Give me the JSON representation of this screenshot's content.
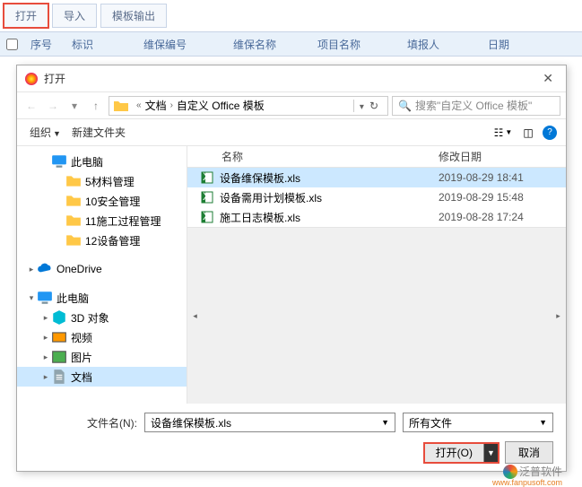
{
  "toolbar": {
    "open": "打开",
    "import": "导入",
    "tplout": "模板输出"
  },
  "grid": {
    "seq": "序号",
    "tag": "标识",
    "maintno": "维保编号",
    "maintname": "维保名称",
    "proj": "项目名称",
    "filler": "填报人",
    "date": "日期"
  },
  "dlg": {
    "title": "打开",
    "crumb": {
      "p1": "文档",
      "p2": "自定义 Office 模板"
    },
    "search_ph": "搜索\"自定义 Office 模板\"",
    "cmds": {
      "org": "组织",
      "newf": "新建文件夹"
    },
    "tree": [
      {
        "ind": 26,
        "exp": "",
        "icon": "pc",
        "label": "此电脑"
      },
      {
        "ind": 42,
        "exp": "",
        "icon": "folder",
        "label": "5材料管理"
      },
      {
        "ind": 42,
        "exp": "",
        "icon": "folder",
        "label": "10安全管理"
      },
      {
        "ind": 42,
        "exp": "",
        "icon": "folder",
        "label": "11施工过程管理"
      },
      {
        "ind": 42,
        "exp": "",
        "icon": "folder",
        "label": "12设备管理"
      },
      {
        "ind": 10,
        "exp": "▸",
        "icon": "onedrive",
        "label": "OneDrive",
        "gap": true
      },
      {
        "ind": 10,
        "exp": "▾",
        "icon": "pc",
        "label": "此电脑",
        "gap": true
      },
      {
        "ind": 26,
        "exp": "▸",
        "icon": "cube",
        "label": "3D 对象"
      },
      {
        "ind": 26,
        "exp": "▸",
        "icon": "video",
        "label": "视频"
      },
      {
        "ind": 26,
        "exp": "▸",
        "icon": "pic",
        "label": "图片"
      },
      {
        "ind": 26,
        "exp": "▸",
        "icon": "doc",
        "label": "文档",
        "sel": true
      }
    ],
    "list": {
      "hdr_name": "名称",
      "hdr_date": "修改日期",
      "rows": [
        {
          "name": "设备维保模板.xls",
          "date": "2019-08-29 18:41",
          "sel": true
        },
        {
          "name": "设备需用计划模板.xls",
          "date": "2019-08-29 15:48"
        },
        {
          "name": "施工日志模板.xls",
          "date": "2019-08-28 17:24"
        }
      ]
    },
    "fname_lbl": "文件名(N):",
    "fname_val": "设备维保模板.xls",
    "filter": "所有文件",
    "open_btn": "打开(O)",
    "cancel": "取消"
  },
  "brand": {
    "name": "泛普软件",
    "url": "www.fanpusoft.com"
  }
}
